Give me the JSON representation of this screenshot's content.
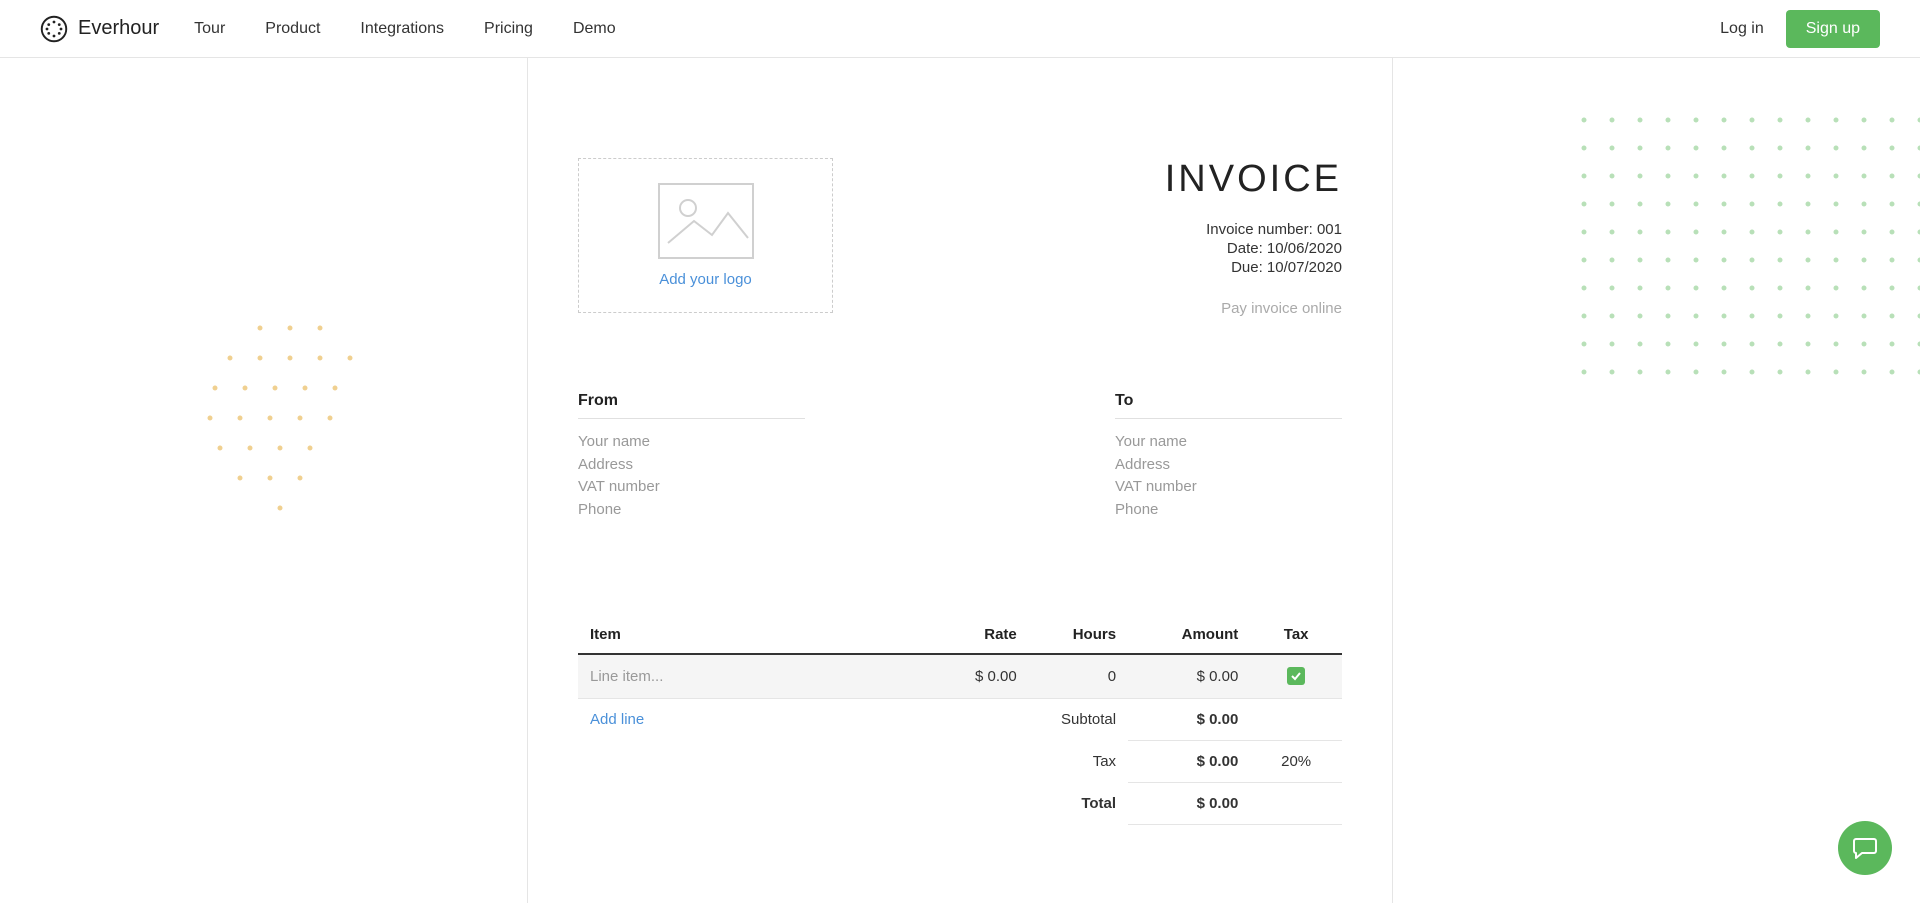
{
  "header": {
    "brand": "Everhour",
    "nav": [
      "Tour",
      "Product",
      "Integrations",
      "Pricing",
      "Demo"
    ],
    "login": "Log in",
    "signup": "Sign up"
  },
  "invoice": {
    "logo_cta": "Add your logo",
    "title": "INVOICE",
    "number_label": "Invoice number: ",
    "number_value": "001",
    "date_label": "Date: ",
    "date_value": "10/06/2020",
    "due_label": "Due: ",
    "due_value": "10/07/2020",
    "pay_online": "Pay invoice online"
  },
  "from": {
    "heading": "From",
    "name": "Your name",
    "address": "Address",
    "vat": "VAT number",
    "phone": "Phone"
  },
  "to": {
    "heading": "To",
    "name": "Your name",
    "address": "Address",
    "vat": "VAT number",
    "phone": "Phone"
  },
  "table": {
    "headers": {
      "item": "Item",
      "rate": "Rate",
      "hours": "Hours",
      "amount": "Amount",
      "tax": "Tax"
    },
    "row": {
      "item_placeholder": "Line item...",
      "rate": "$ 0.00",
      "hours": "0",
      "amount": "$ 0.00"
    },
    "add_line": "Add line",
    "subtotal_label": "Subtotal",
    "subtotal_value": "$ 0.00",
    "tax_label": "Tax",
    "tax_value": "$ 0.00",
    "tax_percent": "20%",
    "total_label": "Total",
    "total_value": "$ 0.00"
  }
}
